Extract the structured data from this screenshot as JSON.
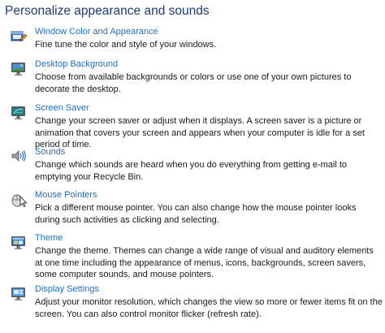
{
  "page": {
    "title": "Personalize appearance and sounds"
  },
  "items": [
    {
      "label": "Window Color and Appearance",
      "icon": "window-color-icon",
      "description": "Fine tune the color and style of your windows."
    },
    {
      "label": "Desktop Background",
      "icon": "desktop-background-icon",
      "description": "Choose from available backgrounds or colors or use one of your own pictures to decorate the desktop."
    },
    {
      "label": "Screen Saver",
      "icon": "screen-saver-icon",
      "description": "Change your screen saver or adjust when it displays. A screen saver is a picture or animation that covers your screen and appears when your computer is idle for a set period of time."
    },
    {
      "label": "Sounds",
      "icon": "sounds-icon",
      "description": "Change which sounds are heard when you do everything from getting e-mail to emptying your Recycle Bin."
    },
    {
      "label": "Mouse Pointers",
      "icon": "mouse-pointer-icon",
      "description": "Pick a different mouse pointer. You can also change how the mouse pointer looks during such activities as clicking and selecting."
    },
    {
      "label": "Theme",
      "icon": "theme-icon",
      "description": "Change the theme. Themes can change a wide range of visual and auditory elements at one time including the appearance of menus, icons, backgrounds, screen savers, some computer sounds, and mouse pointers."
    },
    {
      "label": "Display Settings",
      "icon": "display-settings-icon",
      "description": "Adjust your monitor resolution, which changes the view so more or fewer items fit on the screen. You can also control monitor flicker (refresh rate)."
    }
  ],
  "colors": {
    "title": "#1e3c78",
    "link": "#1f6fc5",
    "text": "#1a1a1a",
    "background": "#ffffff"
  }
}
